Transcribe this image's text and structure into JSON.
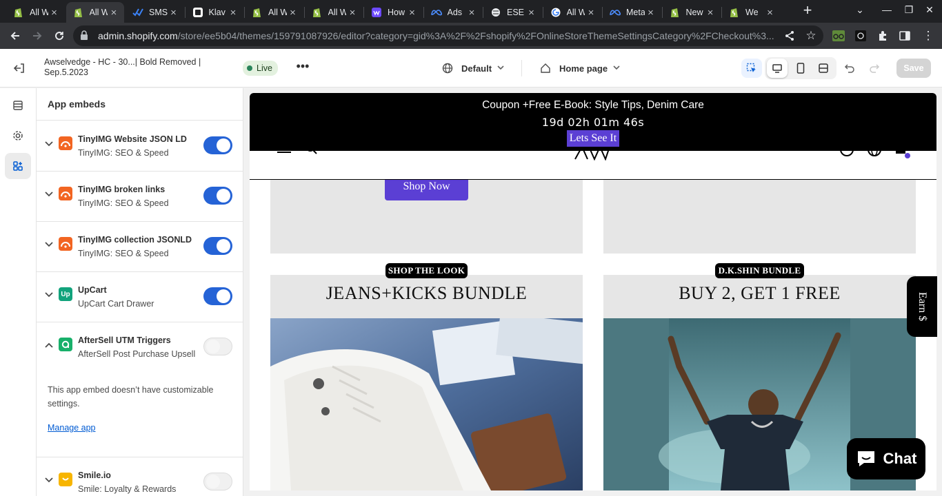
{
  "browser": {
    "tabs": [
      {
        "title": "All W",
        "icon": "shopify-icon"
      },
      {
        "title": "All W",
        "icon": "shopify-icon",
        "active": true
      },
      {
        "title": "SMS",
        "icon": "checkmark-brand-icon"
      },
      {
        "title": "Klav",
        "icon": "klaviyo-icon"
      },
      {
        "title": "All W",
        "icon": "shopify-icon"
      },
      {
        "title": "All W",
        "icon": "shopify-icon"
      },
      {
        "title": "How",
        "icon": "webflow-icon"
      },
      {
        "title": "Ads",
        "icon": "meta-icon"
      },
      {
        "title": "ESE",
        "icon": "globe-icon"
      },
      {
        "title": "All W",
        "icon": "google-icon"
      },
      {
        "title": "Meta",
        "icon": "meta-icon"
      },
      {
        "title": "New",
        "icon": "shopify-icon"
      },
      {
        "title": "We",
        "icon": "shopify-icon"
      }
    ],
    "url_host": "admin.shopify.com",
    "url_path": "/store/ee5b04/themes/159791087926/editor?category=gid%3A%2F%2Fshopify%2FOnlineStoreThemeSettingsCategory%2FCheckout%3..."
  },
  "editor": {
    "theme_name": "Awselvedge - HC - 30...| Bold Removed | Sep.5.2023",
    "live_label": "Live",
    "template_select": "Default",
    "page_select": "Home page",
    "save_label": "Save"
  },
  "panel": {
    "title": "App embeds",
    "embeds": [
      {
        "name": "TinyIMG Website JSON LD",
        "app": "TinyIMG: SEO & Speed",
        "enabled": true,
        "icon_color": "#f26522",
        "icon": "tinyimg-icon"
      },
      {
        "name": "TinyIMG broken links",
        "app": "TinyIMG: SEO & Speed",
        "enabled": true,
        "icon_color": "#f26522",
        "icon": "tinyimg-icon"
      },
      {
        "name": "TinyIMG collection JSONLD",
        "app": "TinyIMG: SEO & Speed",
        "enabled": true,
        "icon_color": "#f26522",
        "icon": "tinyimg-icon"
      },
      {
        "name": "UpCart",
        "app": "UpCart Cart Drawer",
        "enabled": true,
        "icon_color": "#12a37c",
        "icon": "upcart-icon"
      },
      {
        "name": "AfterSell UTM Triggers",
        "app": "AfterSell Post Purchase Upsell",
        "enabled": false,
        "icon_color": "#18b06a",
        "icon": "aftersell-icon"
      },
      {
        "name": "Smile.io",
        "app": "Smile: Loyalty & Rewards",
        "enabled": false,
        "icon_color": "#f7b500",
        "icon": "smile-icon"
      }
    ],
    "expanded_note": "This app embed doesn’t have customizable settings.",
    "manage_link": "Manage app"
  },
  "preview": {
    "announcement": "Coupon +Free E-Book: Style Tips, Denim Care",
    "countdown": "19d 02h 01m 46s",
    "announcement_cta": "Lets See It",
    "shop_now": "Shop Now",
    "card_left_badge": "SHOP THE LOOK",
    "card_left_title": "JEANS+KICKS BUNDLE",
    "card_right_badge": "D.K.SHIN BUNDLE",
    "card_right_title": "BUY 2, GET 1 FREE",
    "earn_tab": "Earn $",
    "chat_label": "Chat"
  },
  "colors": {
    "toggle_on": "#2563d6",
    "accent_purple": "#5b3fd4",
    "live_green": "#29845a"
  }
}
